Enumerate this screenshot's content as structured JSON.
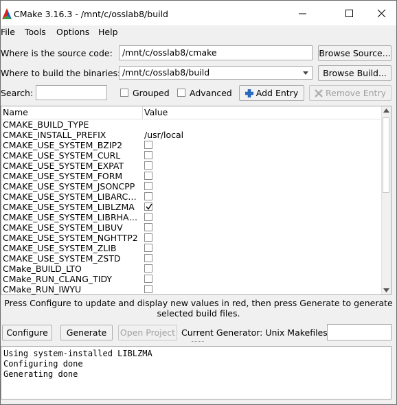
{
  "window": {
    "title": "CMake 3.16.3 - /mnt/c/osslab8/build"
  },
  "menu": {
    "items": [
      "File",
      "Tools",
      "Options",
      "Help"
    ]
  },
  "source": {
    "label": "Where is the source code:",
    "value": "/mnt/c/osslab8/cmake",
    "browse_label": "Browse Source..."
  },
  "build": {
    "label": "Where to build the binaries:",
    "value": "/mnt/c/osslab8/build",
    "browse_label": "Browse Build..."
  },
  "search": {
    "label": "Search:",
    "value": "",
    "grouped_label": "Grouped",
    "advanced_label": "Advanced",
    "add_entry_label": "Add Entry",
    "remove_entry_label": "Remove Entry"
  },
  "table": {
    "col_name": "Name",
    "col_value": "Value",
    "rows": [
      {
        "name": "CMAKE_BUILD_TYPE",
        "type": "text",
        "value": ""
      },
      {
        "name": "CMAKE_INSTALL_PREFIX",
        "type": "text",
        "value": "/usr/local"
      },
      {
        "name": "CMAKE_USE_SYSTEM_BZIP2",
        "type": "bool",
        "checked": false
      },
      {
        "name": "CMAKE_USE_SYSTEM_CURL",
        "type": "bool",
        "checked": false
      },
      {
        "name": "CMAKE_USE_SYSTEM_EXPAT",
        "type": "bool",
        "checked": false
      },
      {
        "name": "CMAKE_USE_SYSTEM_FORM",
        "type": "bool",
        "checked": false
      },
      {
        "name": "CMAKE_USE_SYSTEM_JSONCPP",
        "type": "bool",
        "checked": false
      },
      {
        "name": "CMAKE_USE_SYSTEM_LIBARCH...",
        "type": "bool",
        "checked": false
      },
      {
        "name": "CMAKE_USE_SYSTEM_LIBLZMA",
        "type": "bool",
        "checked": true
      },
      {
        "name": "CMAKE_USE_SYSTEM_LIBRHASH",
        "type": "bool",
        "checked": false
      },
      {
        "name": "CMAKE_USE_SYSTEM_LIBUV",
        "type": "bool",
        "checked": false
      },
      {
        "name": "CMAKE_USE_SYSTEM_NGHTTP2",
        "type": "bool",
        "checked": false
      },
      {
        "name": "CMAKE_USE_SYSTEM_ZLIB",
        "type": "bool",
        "checked": false
      },
      {
        "name": "CMAKE_USE_SYSTEM_ZSTD",
        "type": "bool",
        "checked": false
      },
      {
        "name": "CMake_BUILD_LTO",
        "type": "bool",
        "checked": false
      },
      {
        "name": "CMake_RUN_CLANG_TIDY",
        "type": "bool",
        "checked": false
      },
      {
        "name": "CMake_RUN_IWYU",
        "type": "bool",
        "checked": false
      }
    ]
  },
  "hint": {
    "text": "Press Configure to update and display new values in red, then press Generate to generate selected build files."
  },
  "actions": {
    "configure_label": "Configure",
    "generate_label": "Generate",
    "open_project_label": "Open Project",
    "generator_label": "Current Generator: Unix Makefiles",
    "generator_value": ""
  },
  "log": {
    "lines": [
      "Using system-installed LIBLZMA",
      "Configuring done",
      "Generating done"
    ]
  }
}
